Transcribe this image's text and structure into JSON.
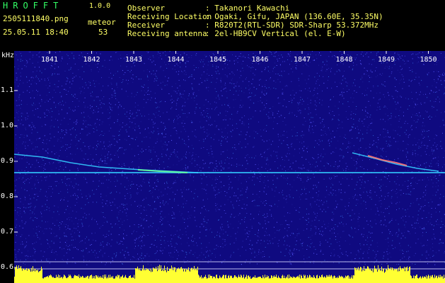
{
  "header": {
    "app_title": "HROFFT",
    "app_version": "1.0.0",
    "file_name": "2505111840.png",
    "type_label": "meteor",
    "datetime": "25.05.11 18:40",
    "count": "53"
  },
  "info": {
    "observer_key": "Observer",
    "observer_val": ": Takanori Kawachi",
    "location_key": "Receiving Location",
    "location_val": ": Ogaki, Gifu, JAPAN (136.60E, 35.35N)",
    "receiver_key": "Receiver",
    "receiver_val": ": R820T2(RTL-SDR) SDR-Sharp 53.372MHz",
    "antenna_key": "Receiving antenna",
    "antenna_val": ": 2el-HB9CV Vertical (el. E-W)"
  },
  "axes": {
    "y_unit": "kHz",
    "y_ticks": [
      "1.1",
      "1.0",
      "0.9",
      "0.8",
      "0.7",
      "0.6"
    ],
    "x_ticks": [
      "1841",
      "1842",
      "1843",
      "1844",
      "1845",
      "1846",
      "1847",
      "1848",
      "1849",
      "1850"
    ]
  },
  "colors": {
    "background": "#000000",
    "spectrogram_bg": "#0f0a80",
    "title_green": "#33ff66",
    "label_yellow": "#ffff66",
    "carrier": "#33ccff",
    "meteor_trail": "#ff7777",
    "activity": "#ffff33"
  }
}
